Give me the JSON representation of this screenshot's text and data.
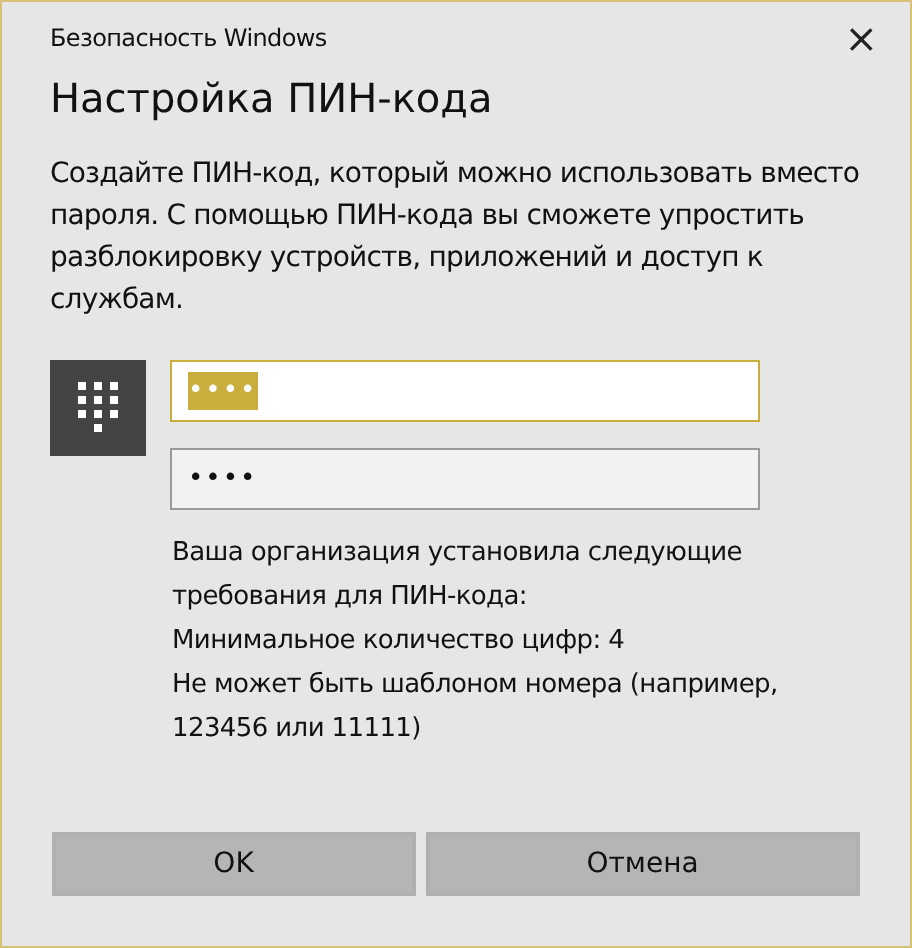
{
  "window": {
    "title": "Безопасность Windows",
    "close": "×"
  },
  "heading": "Настройка ПИН-кода",
  "description": "Создайте ПИН-код, который можно использовать вместо пароля. С помощью ПИН-кода вы сможете упростить разблокировку устройств, приложений и доступ к службам.",
  "fields": [
    {
      "value": "••••",
      "focused": true,
      "text_selected": true
    },
    {
      "value": "••••",
      "focused": false,
      "text_selected": false
    }
  ],
  "requirements": [
    "Ваша организация установила следующие требования для ПИН-кода:",
    "Минимальное количество цифр: 4",
    "Не может быть шаблоном номера (например, 123456 или 11111)"
  ],
  "buttons": [
    "OK",
    "Отмена"
  ]
}
